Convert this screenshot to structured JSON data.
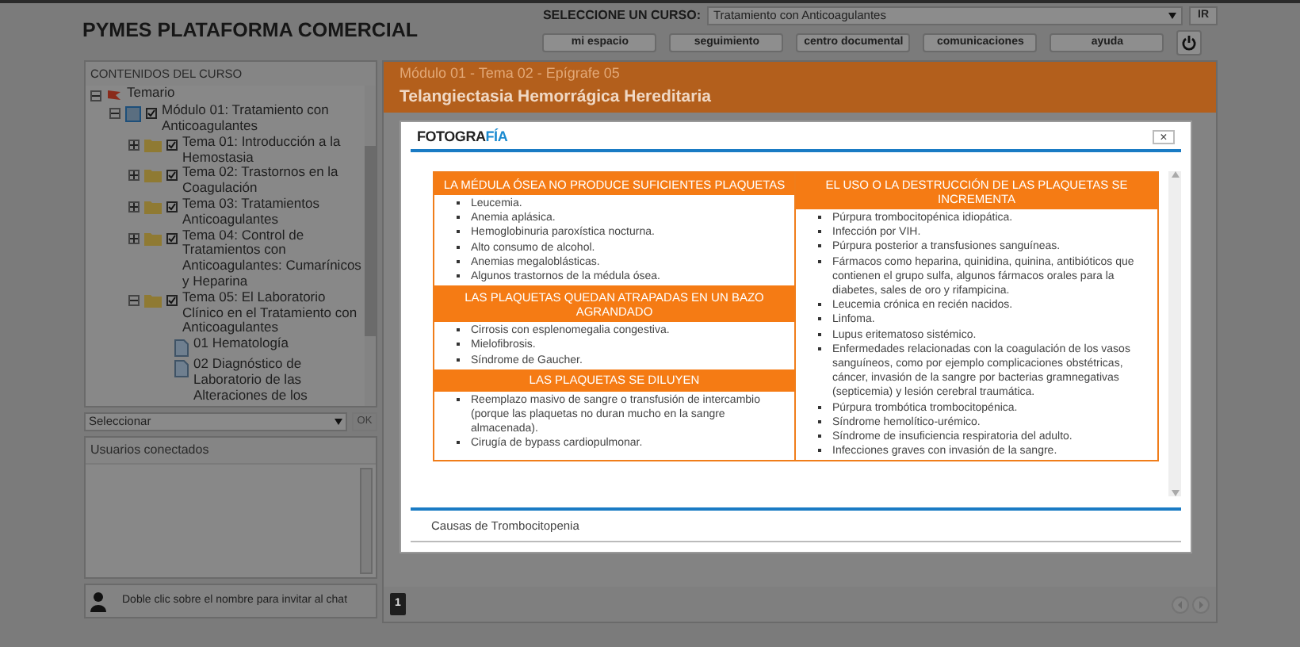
{
  "header": {
    "title": "PYMES PLATAFORMA COMERCIAL",
    "course_label": "SELECCIONE UN CURSO:",
    "course_value": "Tratamiento con Anticoagulantes",
    "go_button": "IR",
    "nav_buttons": [
      "mi espacio",
      "seguimiento",
      "centro documental",
      "comunicaciones",
      "ayuda"
    ]
  },
  "sidebar": {
    "contents_title": "CONTENIDOS DEL CURSO",
    "tree": [
      {
        "kind": "root",
        "label": "Temario",
        "expanded": true,
        "children": [
          {
            "kind": "module",
            "label": "Módulo 01: Tratamiento con Anticoagulantes",
            "expanded": true,
            "checked": true,
            "children": [
              {
                "kind": "topic",
                "label": "Tema 01: Introducción a la Hemostasia",
                "expanded": false,
                "checked": true
              },
              {
                "kind": "topic",
                "label": "Tema 02: Trastornos en la Coagulación",
                "expanded": false,
                "checked": true
              },
              {
                "kind": "topic",
                "label": "Tema 03: Tratamientos Anticoagulantes",
                "expanded": false,
                "checked": true
              },
              {
                "kind": "topic",
                "label": "Tema 04: Control de Tratamientos con Anticoagulantes: Cumarínicos y Heparina",
                "expanded": false,
                "checked": true
              },
              {
                "kind": "topic",
                "label": "Tema 05: El Laboratorio Clínico en el Tratamiento con Anticoagulantes",
                "expanded": true,
                "checked": true,
                "children": [
                  {
                    "kind": "doc",
                    "label": "01 Hematología"
                  },
                  {
                    "kind": "doc",
                    "label": "02 Diagnóstico de Laboratorio de las Alteraciones de los"
                  }
                ]
              }
            ]
          }
        ]
      }
    ],
    "select_placeholder": "Seleccionar",
    "ok_button": "OK",
    "users_title": "Usuarios conectados",
    "chat_hint": "Doble clic sobre el nombre para invitar al chat"
  },
  "content": {
    "breadcrumb": "Módulo 01 - Tema 02 - Epígrafe 05",
    "title": "Telangiectasia Hemorrágica Hereditaria",
    "page_button": "1"
  },
  "modal": {
    "logo": {
      "text": "FOTOGRA",
      "accent": "FÍA"
    },
    "close": "×",
    "caption": "Causas de Trombocitopenia",
    "columns": [
      {
        "sections": [
          {
            "heading": "LA MÉDULA ÓSEA NO PRODUCE SUFICIENTES PLAQUETAS",
            "items": [
              "Leucemia.",
              "Anemia aplásica.",
              "Hemoglobinuria paroxística nocturna.",
              "Alto consumo de alcohol.",
              "Anemias megaloblásticas.",
              "Algunos trastornos de la médula ósea."
            ]
          },
          {
            "heading": "LAS PLAQUETAS QUEDAN ATRAPADAS EN UN BAZO AGRANDADO",
            "items": [
              "Cirrosis con esplenomegalia congestiva.",
              "Mielofibrosis.",
              "Síndrome de Gaucher."
            ]
          },
          {
            "heading": "LAS PLAQUETAS SE DILUYEN",
            "items": [
              "Reemplazo masivo de sangre o transfusión de intercambio (porque las plaquetas no duran mucho en la sangre almacenada).",
              "Cirugía de bypass cardiopulmonar."
            ]
          }
        ]
      },
      {
        "sections": [
          {
            "heading": "EL USO O LA DESTRUCCIÓN DE LAS PLAQUETAS SE INCREMENTA",
            "items": [
              "Púrpura trombocitopénica idiopática.",
              "Infección por VIH.",
              "Púrpura posterior a transfusiones sanguíneas.",
              "Fármacos como heparina, quinidina, quinina, antibióticos que contienen el grupo sulfa, algunos fármacos orales para la diabetes, sales de oro y rifampicina.",
              "Leucemia crónica en recién nacidos.",
              "Linfoma.",
              "Lupus eritematoso sistémico.",
              "Enfermedades relacionadas con la coagulación de los vasos sanguíneos, como por ejemplo complicaciones obstétricas, cáncer, invasión de la sangre por bacterias gramnegativas (septicemia) y lesión cerebral traumática.",
              "Púrpura trombótica trombocitopénica.",
              "Síndrome hemolítico-urémico.",
              "Síndrome de insuficiencia respiratoria del adulto.",
              "Infecciones graves con invasión de la sangre."
            ]
          }
        ]
      }
    ]
  }
}
